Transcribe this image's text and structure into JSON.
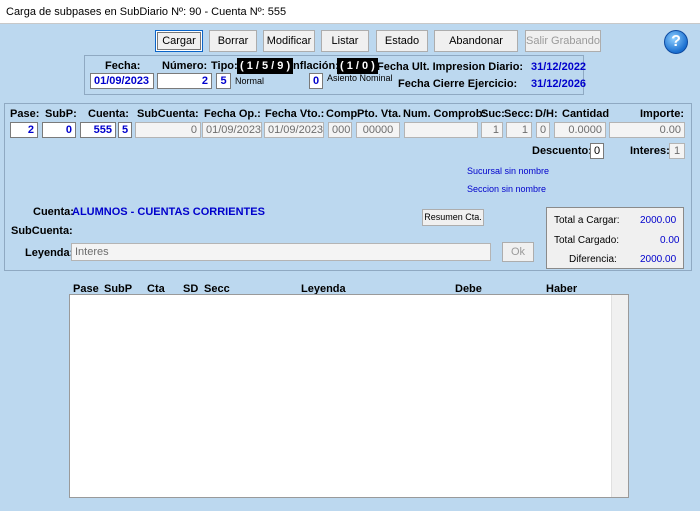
{
  "window": {
    "title": "Carga de subpases en SubDiario Nº: 90 - Cuenta Nº: 555"
  },
  "toolbar": {
    "cargar": "Cargar",
    "borrar": "Borrar",
    "modificar": "Modificar",
    "listar": "Listar",
    "estado": "Estado",
    "abandonar": "Abandonar",
    "salir_grabando": "Salir Grabando",
    "help": "?"
  },
  "header": {
    "fecha_label": "Fecha:",
    "fecha_value": "01/09/2023",
    "numero_label": "Número:",
    "numero_value": "2",
    "tipo_label": "Tipo:",
    "tipo_tag": "( 1 / 5 / 9 )",
    "tipo_value": "5",
    "tipo_desc": "Normal",
    "inflacion_label": "Inflación:",
    "inflacion_tag": "( 1 / 0 )",
    "inflacion_value": "0",
    "inflacion_desc": "Asiento Nominal",
    "ult_impresion_label": "Fecha Ult. Impresion Diario:",
    "ult_impresion_value": "31/12/2022",
    "cierre_label": "Fecha Cierre Ejercicio:",
    "cierre_value": "31/12/2026"
  },
  "entry": {
    "labels": {
      "pase": "Pase:",
      "subp": "SubP:",
      "cuenta": "Cuenta:",
      "subcuenta": "SubCuenta:",
      "fecha_op": "Fecha Op.:",
      "fecha_vto": "Fecha Vto.:",
      "comp": "Comp.",
      "pto_vta": "Pto. Vta.",
      "num_comprob": "Num. Comprob:",
      "suc": "Suc:",
      "secc": "Secc:",
      "dh": "D/H:",
      "cantidad": "Cantidad",
      "importe": "Importe:"
    },
    "values": {
      "pase": "2",
      "subp": "0",
      "cuenta": "555",
      "cuenta_sub": "5",
      "subcuenta": "0",
      "fecha_op": "01/09/2023",
      "fecha_vto": "01/09/2023",
      "comp": "000",
      "pto_vta": "00000",
      "num_comprob": "",
      "suc": "1",
      "secc": "1",
      "dh": "0",
      "cantidad": "0.0000",
      "importe": "0.00"
    },
    "descuento_label": "Descuento:",
    "descuento_value": "0",
    "intereses_label": "Interes:",
    "intereses_value": "1",
    "sucursal_text": "Sucursal sin nombre",
    "seccion_text": "Seccion sin nombre"
  },
  "account": {
    "cuenta_label": "Cuenta:",
    "cuenta_value": "ALUMNOS - CUENTAS CORRIENTES",
    "subcuenta_label": "SubCuenta:",
    "leyenda_label": "Leyenda:",
    "leyenda_value": "Interes",
    "ok_label": "Ok",
    "resumen_label": "Resumen Cta."
  },
  "totals": {
    "total_cargar_label": "Total a Cargar:",
    "total_cargar_value": "2000.00",
    "total_cargado_label": "Total Cargado:",
    "total_cargado_value": "0.00",
    "diferencia_label": "Diferencia:",
    "diferencia_value": "2000.00"
  },
  "grid": {
    "columns": [
      "Pase",
      "SubP",
      "Cta",
      "SD",
      "Secc",
      "Leyenda",
      "Debe",
      "Haber"
    ],
    "rows": []
  }
}
